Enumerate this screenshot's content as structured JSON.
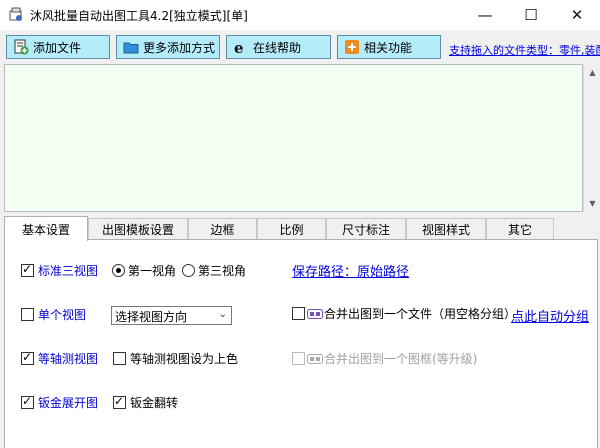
{
  "window": {
    "title": "沐风批量自动出图工具4.2[独立模式][单]",
    "min_glyph": "—",
    "max_glyph": "☐",
    "close_glyph": "✕"
  },
  "toolbar": {
    "add_file": "添加文件",
    "more_add": "更多添加方式",
    "online_help": "在线帮助",
    "related": "相关功能",
    "support_link": "支持拖入的文件类型：零件,装配"
  },
  "tabs": [
    "基本设置",
    "出图模板设置",
    "边框",
    "比例",
    "尺寸标注",
    "视图样式",
    "其它"
  ],
  "basic": {
    "standard_views": "标准三视图",
    "first_angle": "第一视角",
    "third_angle": "第三视角",
    "save_path": "保存路径：原始路径",
    "single_view": "单个视图",
    "view_direction": "选择视图方向",
    "merge_one_file": "合并出图到一个文件（用空格分组）",
    "auto_group": "点此自动分组",
    "isometric": "等轴测视图",
    "iso_color": "等轴测视图设为上色",
    "merge_one_frame": "合并出图到一个图框(等升级)",
    "sheet_flat": "钣金展开图",
    "sheet_flip": "钣金翻转"
  },
  "state": {
    "standard_views_checked": true,
    "first_angle_selected": true,
    "single_view_checked": false,
    "merge_one_file_checked": false,
    "isometric_checked": true,
    "iso_color_checked": false,
    "merge_one_frame_checked": false,
    "sheet_flat_checked": true,
    "sheet_flip_checked": true
  },
  "colors": {
    "button_bg": "#b4ecfa",
    "list_bg": "#f2fff2",
    "link": "#0000e0",
    "label_blue": "#0000d0"
  },
  "icons": [
    "app-icon",
    "add-file-icon",
    "folder-icon",
    "ie-icon",
    "plus-icon",
    "merge-icon"
  ]
}
